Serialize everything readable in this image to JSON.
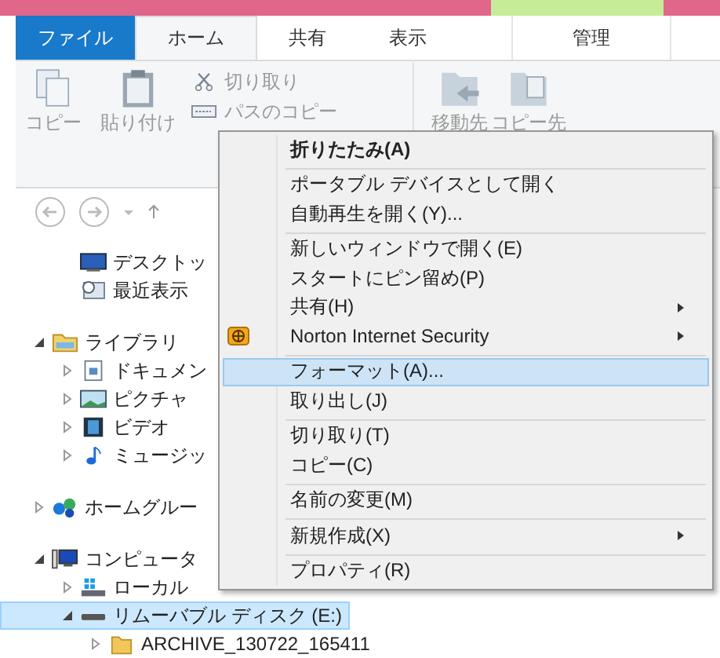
{
  "tabs": [
    {
      "label": "ファイル",
      "kind": "file",
      "selected": false,
      "contextual": false
    },
    {
      "label": "ホーム",
      "kind": "tab",
      "selected": true,
      "contextual": false
    },
    {
      "label": "共有",
      "kind": "tab",
      "selected": false,
      "contextual": false
    },
    {
      "label": "表示",
      "kind": "tab",
      "selected": false,
      "contextual": false
    },
    {
      "label": "管理",
      "kind": "tab",
      "selected": false,
      "contextual": true
    }
  ],
  "ribbon": {
    "clipboard": {
      "large": [
        {
          "label": "コピー",
          "kind": "copy"
        },
        {
          "label": "貼り付け",
          "kind": "paste"
        }
      ],
      "small": [
        {
          "label": "切り取り",
          "kind": "cut"
        },
        {
          "label": "パスのコピー",
          "kind": "path"
        }
      ]
    },
    "organize": [
      {
        "label": "移動先",
        "kind": "move"
      },
      {
        "label": "コピー先",
        "kind": "copyto"
      }
    ]
  },
  "tree": [
    {
      "children": [
        {
          "label": "デスクトッ",
          "kind": "desktop",
          "selected": false
        },
        {
          "label": "最近表示",
          "kind": "recent",
          "selected": false
        }
      ]
    },
    {
      "label": "ライブラリ",
      "kind": "library",
      "expanded": true,
      "selected": false,
      "children": [
        {
          "label": "ドキュメン",
          "kind": "document",
          "expanded": false,
          "selected": false
        },
        {
          "label": "ピクチャ",
          "kind": "picture",
          "expanded": false,
          "selected": false
        },
        {
          "label": "ビデオ",
          "kind": "video",
          "expanded": false,
          "selected": false
        },
        {
          "label": "ミュージッ",
          "kind": "music",
          "expanded": false,
          "selected": false
        }
      ]
    },
    {
      "label": "ホームグルー",
      "kind": "homegroup",
      "expanded": false,
      "selected": false
    },
    {
      "label": "コンピュータ",
      "kind": "computer",
      "expanded": true,
      "selected": false,
      "children": [
        {
          "label": "ローカル",
          "kind": "disk",
          "expanded": false,
          "selected": false
        },
        {
          "label": "リムーバブル ディスク (E:)",
          "kind": "removable",
          "expanded": true,
          "selected": true,
          "children": [
            {
              "label": "ARCHIVE_130722_165411",
              "kind": "folder",
              "expanded": false,
              "selected": false
            }
          ]
        }
      ]
    }
  ],
  "context_menu": [
    [
      {
        "label": "折りたたみ(A)",
        "default": true,
        "submenu": false,
        "selected": false
      }
    ],
    [
      {
        "label": "ポータブル デバイスとして開く",
        "default": false,
        "submenu": false,
        "selected": false
      },
      {
        "label": "自動再生を開く(Y)...",
        "default": false,
        "submenu": false,
        "selected": false
      }
    ],
    [
      {
        "label": "新しいウィンドウで開く(E)",
        "default": false,
        "submenu": false,
        "selected": false
      },
      {
        "label": "スタートにピン留め(P)",
        "default": false,
        "submenu": false,
        "selected": false
      },
      {
        "label": "共有(H)",
        "default": false,
        "submenu": true,
        "selected": false
      },
      {
        "label": "Norton Internet Security",
        "default": false,
        "submenu": true,
        "selected": false,
        "kind": "norton"
      }
    ],
    [
      {
        "label": "フォーマット(A)...",
        "default": false,
        "submenu": false,
        "selected": true
      },
      {
        "label": "取り出し(J)",
        "default": false,
        "submenu": false,
        "selected": false
      }
    ],
    [
      {
        "label": "切り取り(T)",
        "default": false,
        "submenu": false,
        "selected": false
      },
      {
        "label": "コピー(C)",
        "default": false,
        "submenu": false,
        "selected": false
      }
    ],
    [
      {
        "label": "名前の変更(M)",
        "default": false,
        "submenu": false,
        "selected": false
      }
    ],
    [
      {
        "label": "新規作成(X)",
        "default": false,
        "submenu": true,
        "selected": false
      }
    ],
    [
      {
        "label": "プロパティ(R)",
        "default": false,
        "submenu": false,
        "selected": false
      }
    ]
  ]
}
